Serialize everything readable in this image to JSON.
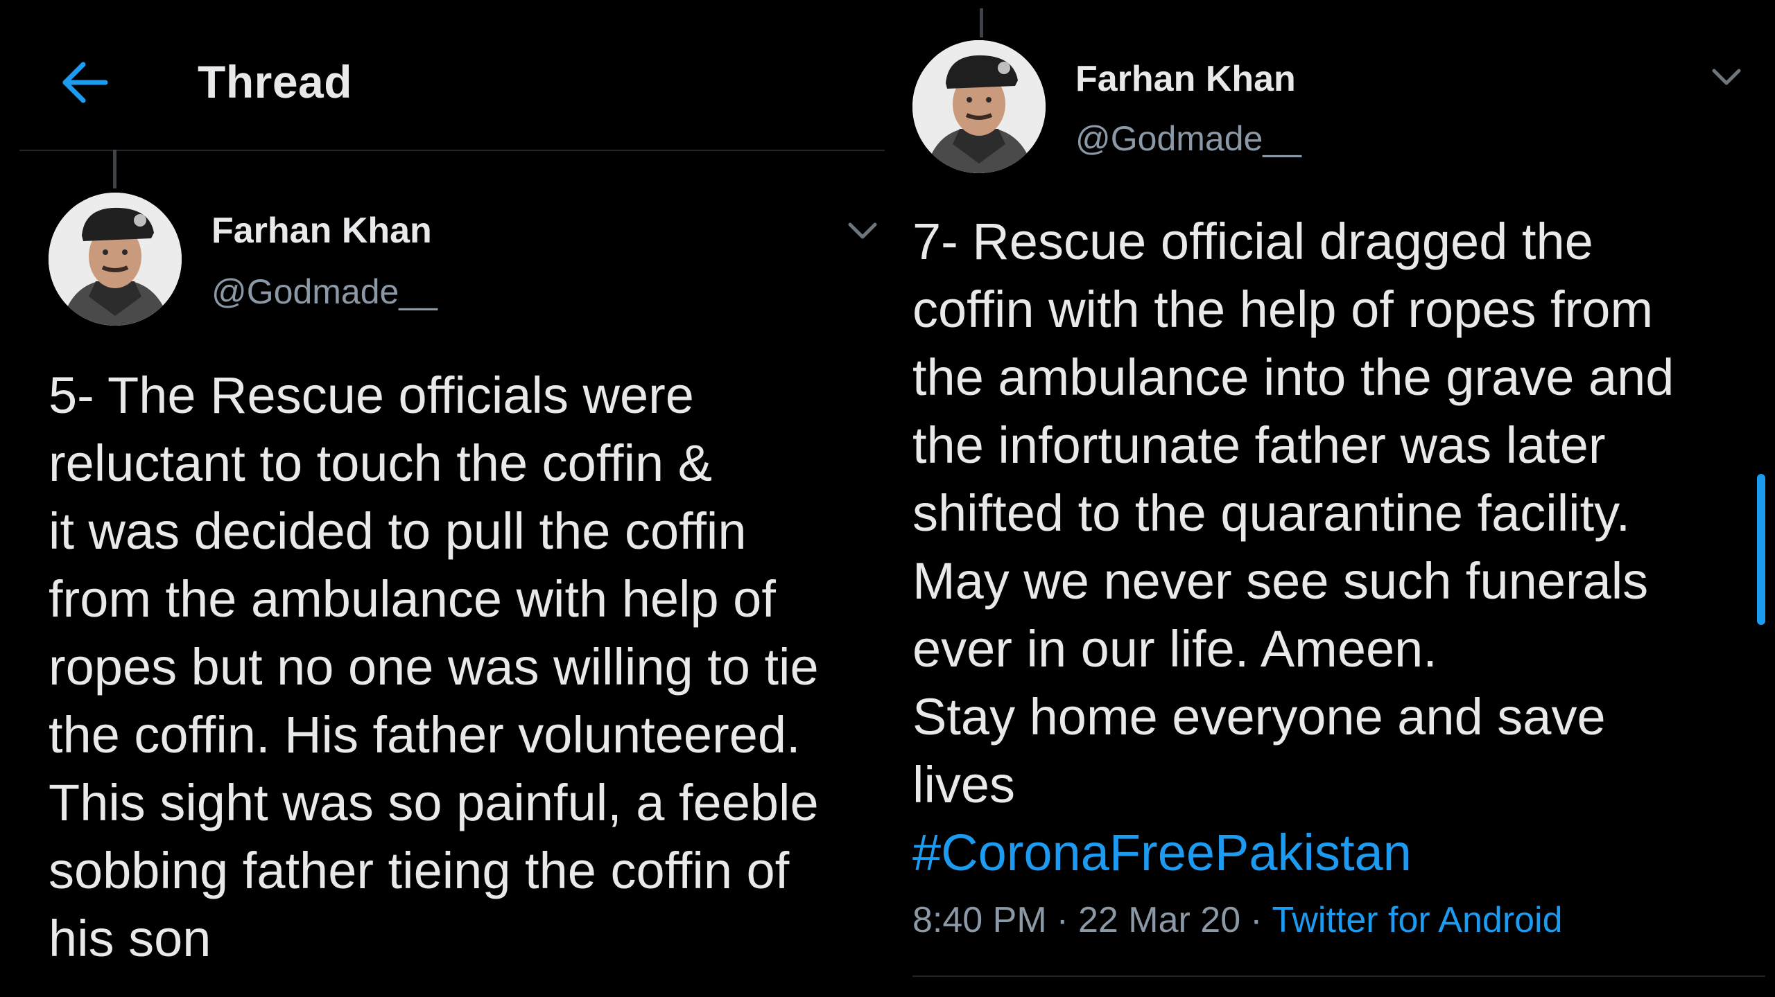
{
  "left": {
    "header": {
      "title": "Thread",
      "back_icon": "arrow-left-icon"
    },
    "user": {
      "display_name": "Farhan Khan",
      "handle": "@Godmade__"
    },
    "tweet_lines": [
      "5- The Rescue officials were",
      "reluctant to touch the coffin &",
      "it was decided to pull the coffin",
      "from the ambulance with help of",
      "ropes but no one was willing to tie",
      "the coffin. His father volunteered.",
      "This sight was so painful, a feeble",
      "sobbing father tieing the coffin of",
      "his son"
    ]
  },
  "right": {
    "user": {
      "display_name": "Farhan Khan",
      "handle": "@Godmade__"
    },
    "tweet_lines": [
      "7- Rescue official dragged the",
      "coffin with the help of ropes from",
      "the ambulance into the grave and",
      "the infortunate father was later",
      "shifted to the quarantine facility.",
      "May we never see such funerals",
      "ever in our life. Ameen.",
      "Stay home everyone and save",
      "lives"
    ],
    "hashtag": "#CoronaFreePakistan",
    "meta": {
      "time": "8:40 PM",
      "separator": "·",
      "date": "22 Mar 20",
      "source": "Twitter for Android"
    }
  },
  "colors": {
    "background": "#000000",
    "text": "#e7e9ea",
    "secondary_text": "#8b98a5",
    "accent": "#1d9bf0"
  }
}
